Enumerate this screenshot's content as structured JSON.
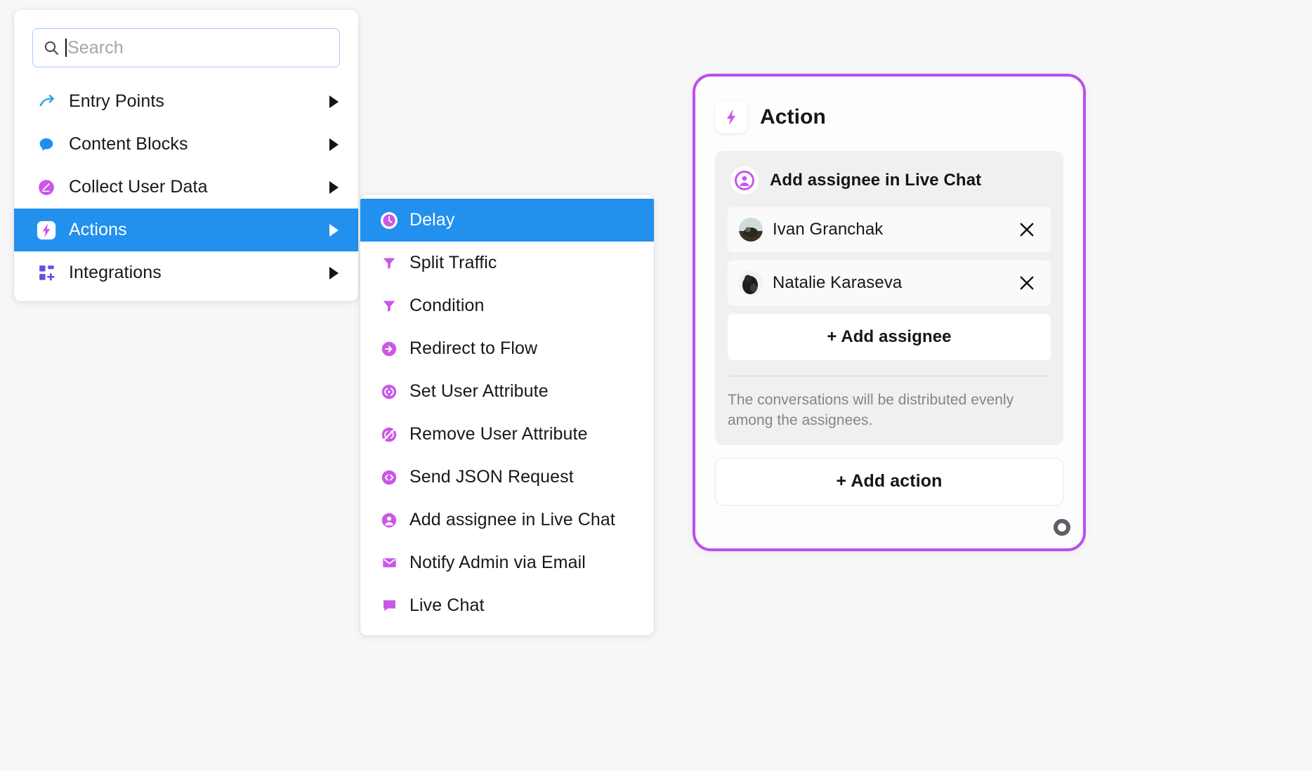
{
  "search": {
    "placeholder": "Search",
    "icon": "search-icon"
  },
  "menu": {
    "items": [
      {
        "label": "Entry Points",
        "icon": "arrow-curve-icon",
        "active": false
      },
      {
        "label": "Content Blocks",
        "icon": "chat-bubble-icon",
        "active": false
      },
      {
        "label": "Collect User Data",
        "icon": "pencil-circle-icon",
        "active": false
      },
      {
        "label": "Actions",
        "icon": "lightning-bolt-icon",
        "active": true
      },
      {
        "label": "Integrations",
        "icon": "grid-plus-icon",
        "active": false
      }
    ]
  },
  "submenu": {
    "items": [
      {
        "label": "Delay",
        "icon": "clock-icon",
        "active": true
      },
      {
        "label": "Split Traffic",
        "icon": "funnel-icon",
        "active": false
      },
      {
        "label": "Condition",
        "icon": "funnel-icon",
        "active": false
      },
      {
        "label": "Redirect to Flow",
        "icon": "arrow-right-circle-icon",
        "active": false
      },
      {
        "label": "Set User Attribute",
        "icon": "code-circle-icon",
        "active": false
      },
      {
        "label": "Remove User Attribute",
        "icon": "code-slash-circle-icon",
        "active": false
      },
      {
        "label": "Send JSON Request",
        "icon": "json-circle-icon",
        "active": false
      },
      {
        "label": "Add assignee in Live Chat",
        "icon": "person-circle-icon",
        "active": false
      },
      {
        "label": "Notify Admin via Email",
        "icon": "envelope-icon",
        "active": false
      },
      {
        "label": "Live Chat",
        "icon": "chat-square-icon",
        "active": false
      }
    ]
  },
  "action_card": {
    "title": "Action",
    "badge_icon": "lightning-bolt-icon",
    "block": {
      "title": "Add assignee in Live Chat",
      "icon": "person-circle-icon",
      "assignees": [
        {
          "name": "Ivan Granchak",
          "remove_label": "×"
        },
        {
          "name": "Natalie Karaseva",
          "remove_label": "×"
        }
      ],
      "add_assignee_label": "+ Add assignee",
      "hint": "The conversations will be distributed evenly among the assignees."
    },
    "add_action_label": "+ Add action",
    "handle_icon": "node-connector-handle"
  },
  "colors": {
    "highlight_blue": "#2290ee",
    "accent_purple": "#bb4ff0",
    "panel_bg": "#ffffff",
    "page_bg": "#f7f7f8",
    "block_bg": "#f0f0f1"
  }
}
